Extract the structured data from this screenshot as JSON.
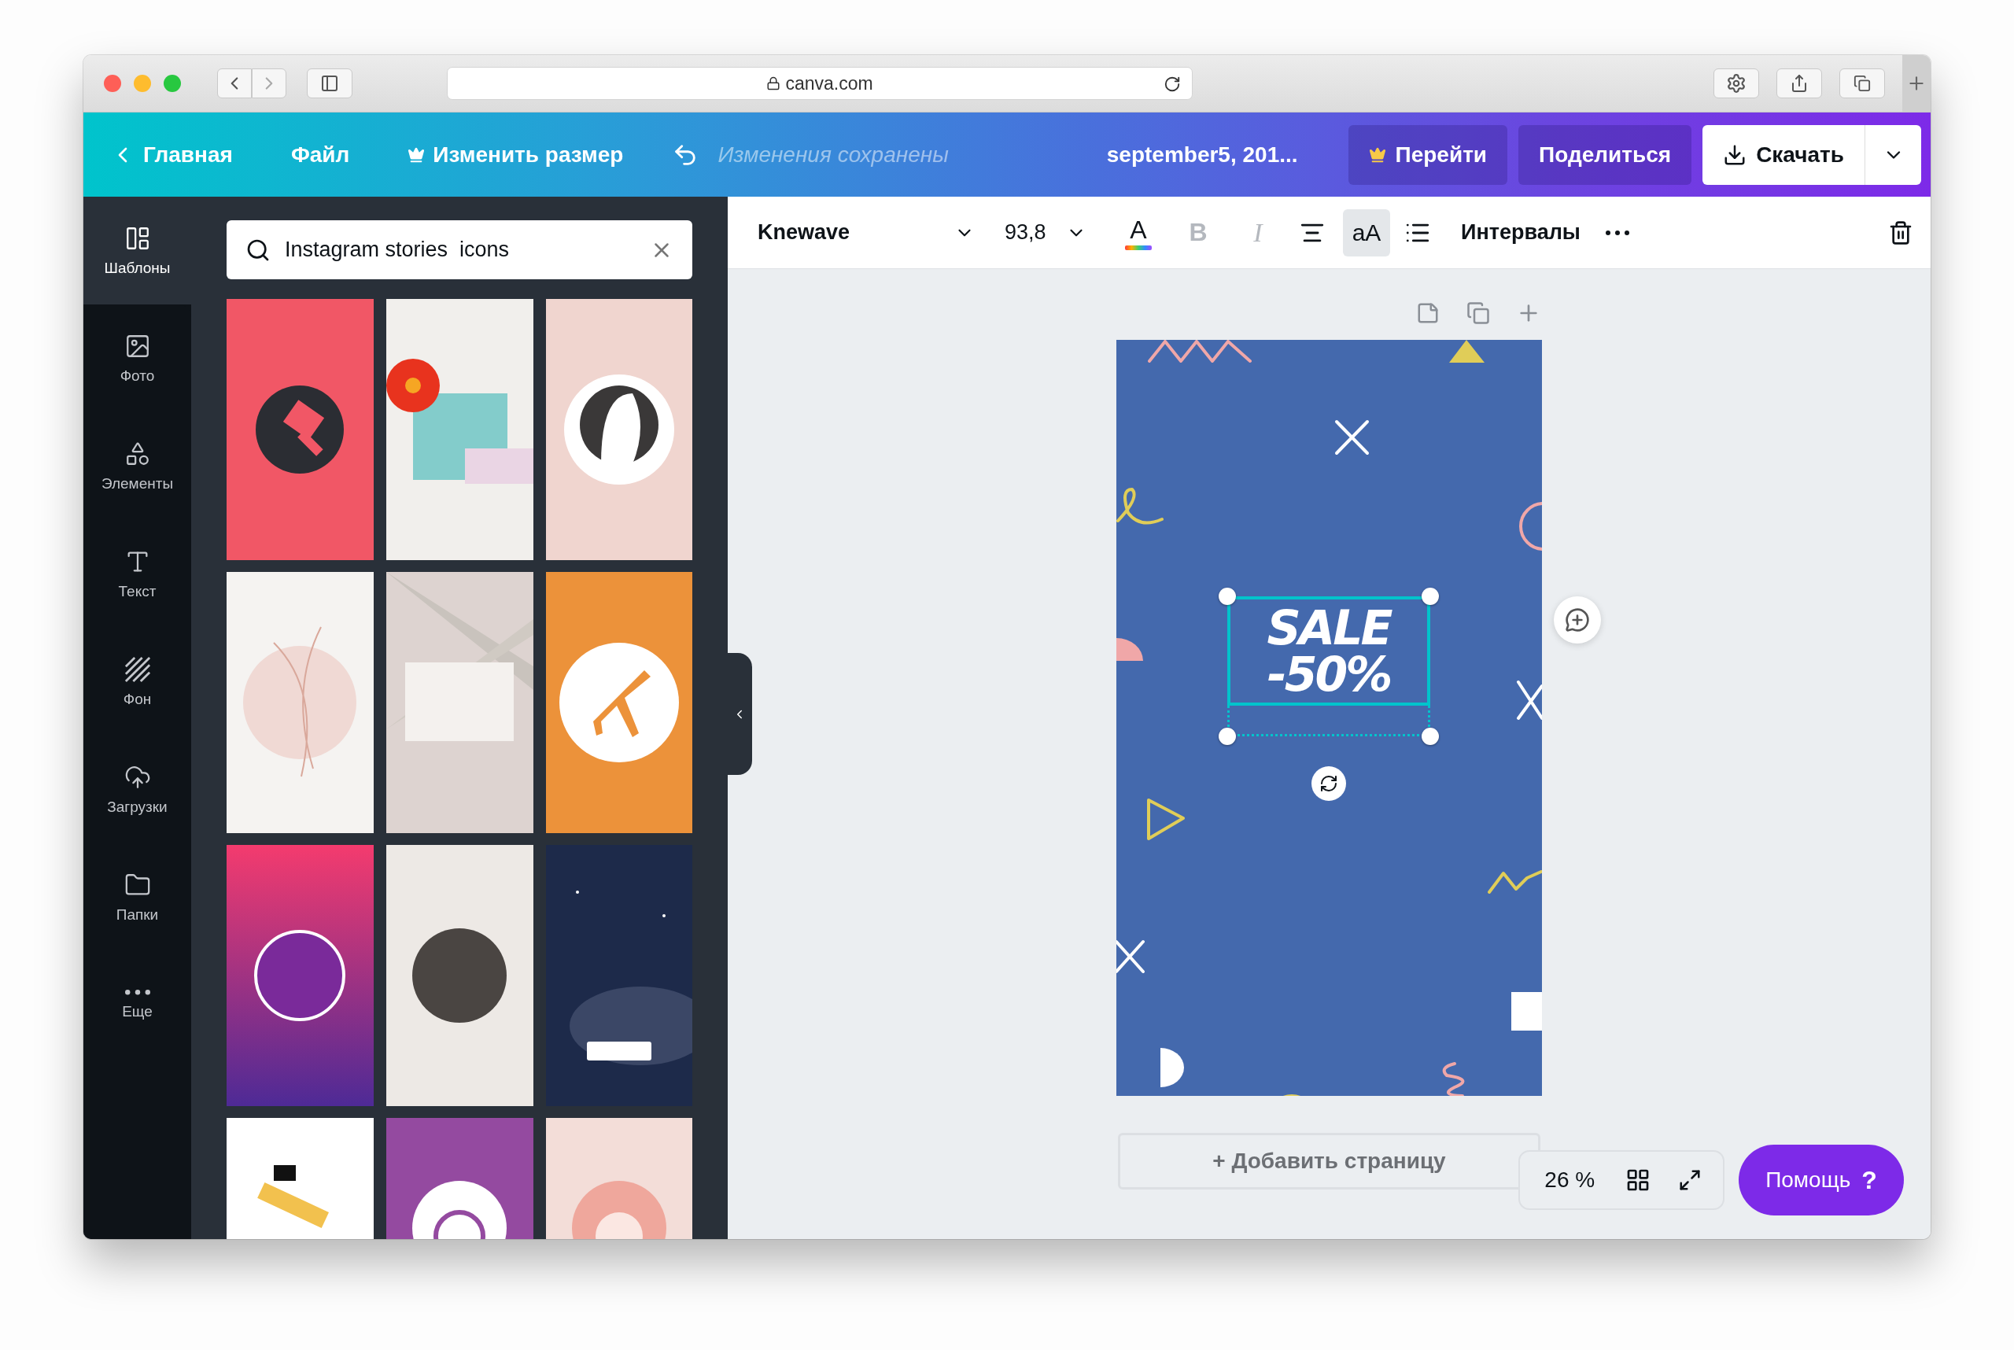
{
  "browser": {
    "url": "canva.com"
  },
  "header": {
    "back": "Главная",
    "menu": [
      {
        "kind": "plain",
        "label": "Файл"
      },
      {
        "kind": "crown",
        "label": "Изменить размер"
      }
    ],
    "status": "Изменения сохранены",
    "title": "september5, 201...",
    "buttons": [
      {
        "kind": "upgrade",
        "label": "Перейти"
      },
      {
        "kind": "share",
        "label": "Поделиться"
      },
      {
        "kind": "download",
        "label": "Скачать"
      }
    ]
  },
  "sidebar": {
    "items": [
      {
        "label": "Шаблоны",
        "selected": true
      },
      {
        "label": "Фото",
        "selected": false
      },
      {
        "label": "Элементы",
        "selected": false
      },
      {
        "label": "Текст",
        "selected": false
      },
      {
        "label": "Фон",
        "selected": false
      },
      {
        "label": "Загрузки",
        "selected": false
      },
      {
        "label": "Папки",
        "selected": false
      },
      {
        "label": "Еще",
        "selected": false
      }
    ]
  },
  "panel": {
    "search": {
      "value": "Instagram stories  icons"
    }
  },
  "toolbar": {
    "font": "Knewave",
    "size": "93,8",
    "tools": [
      {
        "kind": "color",
        "label": "A"
      },
      {
        "kind": "bold",
        "label": "B",
        "disabled": true
      },
      {
        "kind": "italic",
        "label": "I",
        "disabled": true
      },
      {
        "kind": "align"
      },
      {
        "kind": "case",
        "label": "aA",
        "selected": true
      },
      {
        "kind": "list"
      }
    ],
    "spacing": "Интервалы"
  },
  "design": {
    "headline": [
      "SALE",
      "-50%"
    ],
    "selected": true
  },
  "add_page": "+ Добавить страницу",
  "zoom": "26 %",
  "help": {
    "label": "Помощь",
    "mark": "?"
  }
}
